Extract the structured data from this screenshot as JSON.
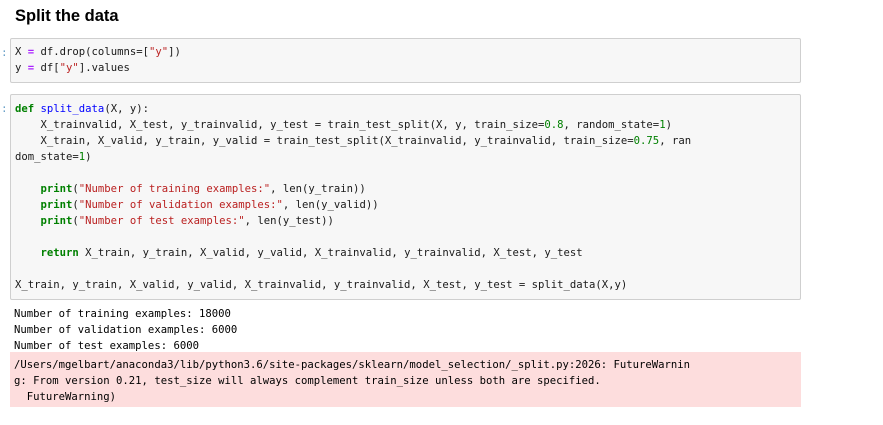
{
  "heading": "Split the data",
  "cell1": {
    "line1_var": "X",
    "line1_eq": " = ",
    "line1_rest_a": "df.drop(columns=[",
    "line1_str": "\"y\"",
    "line1_rest_b": "])",
    "line2_var": "y",
    "line2_eq": " = ",
    "line2_rest_a": "df[",
    "line2_str": "\"y\"",
    "line2_rest_b": "].values"
  },
  "cell2": {
    "def_kw": "def",
    "fn_name": "split_data",
    "def_rest": "(X, y):",
    "line2": "    X_trainvalid, X_test, y_trainvalid, y_test = train_test_split(X, y, train_size=",
    "line2_num1": "0.8",
    "line2_mid": ", random_state=",
    "line2_num2": "1",
    "line2_end": ")",
    "line3": "    X_train, X_valid, y_train, y_valid = train_test_split(X_trainvalid, y_trainvalid, train_size=",
    "line3_num": "0.75",
    "line3_end": ", ran",
    "line4": "dom_state=",
    "line4_num": "1",
    "line4_end": ")",
    "print_kw": "print",
    "print1_str": "\"Number of training examples:\"",
    "print1_rest": ", len(y_train))",
    "print2_str": "\"Number of validation examples:\"",
    "print2_rest": ", len(y_valid))",
    "print3_str": "\"Number of test examples:\"",
    "print3_rest": ", len(y_test))",
    "return_kw": "return",
    "return_rest": " X_train, y_train, X_valid, y_valid, X_trainvalid, y_trainvalid, X_test, y_test",
    "call_line": "X_train, y_train, X_valid, y_valid, X_trainvalid, y_trainvalid, X_test, y_test = split_data(X,y)"
  },
  "output": {
    "line1": "Number of training examples: 18000",
    "line2": "Number of validation examples: 6000",
    "line3": "Number of test examples: 6000"
  },
  "warning": {
    "line1": "/Users/mgelbart/anaconda3/lib/python3.6/site-packages/sklearn/model_selection/_split.py:2026: FutureWarnin",
    "line2": "g: From version 0.21, test_size will always complement train_size unless both are specified.",
    "line3": "  FutureWarning)"
  },
  "colors": {
    "keyword": "#008000",
    "function": "#0000ff",
    "string": "#ba2121",
    "warning_bg": "#fddddd",
    "cell_bg": "#f7f7f7"
  }
}
